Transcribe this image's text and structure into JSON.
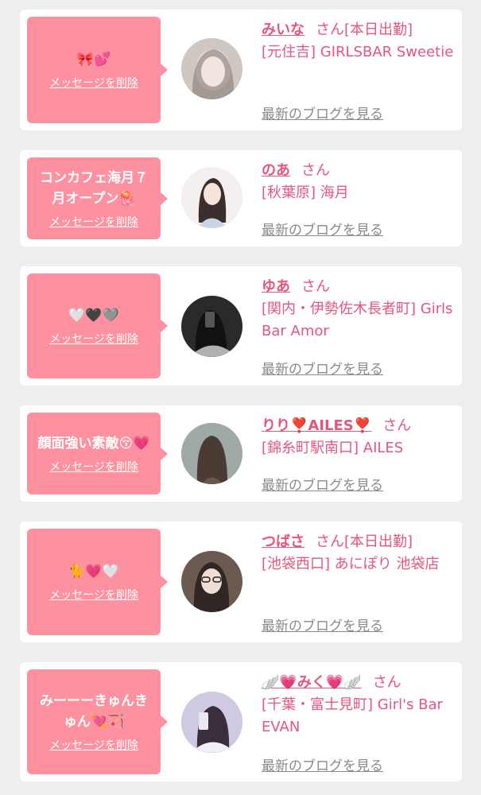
{
  "delete_label": "メッセージを削除",
  "blog_label": "最新のブログを見る",
  "san": "さん",
  "cards": [
    {
      "message": "🎀💕",
      "name": "みいな",
      "work": "[本日出勤]",
      "shop": "[元住吉] GIRLSBAR Sweetie"
    },
    {
      "message": "コンカフェ海月７月オープン🪼",
      "name": "のあ",
      "work": "",
      "shop": "[秋葉原] 海月"
    },
    {
      "message": "🤍🖤🩶",
      "name": "ゆあ",
      "work": "",
      "shop": "[関内・伊勢佐木長者町] Girls Bar Amor"
    },
    {
      "message": "顔面強い素敵😚💗",
      "name": "りり❣️AILES❣️",
      "work": "",
      "shop": "[錦糸町駅南口] AILES"
    },
    {
      "message": "🐈💗🤍",
      "name": "つばさ",
      "work": "[本日出勤]",
      "shop": "[池袋西口] あにぽり 池袋店"
    },
    {
      "message": "みーーーきゅんきゅん💘🏹",
      "name": "🪽💗みく💗🪽",
      "work": "",
      "shop": "[千葉・富士見町] Girl's Bar EVAN"
    }
  ],
  "colors": {
    "bubble": "#fd919f",
    "accent": "#e6567c",
    "link": "#8a8a8a",
    "background": "#eeeeee"
  }
}
